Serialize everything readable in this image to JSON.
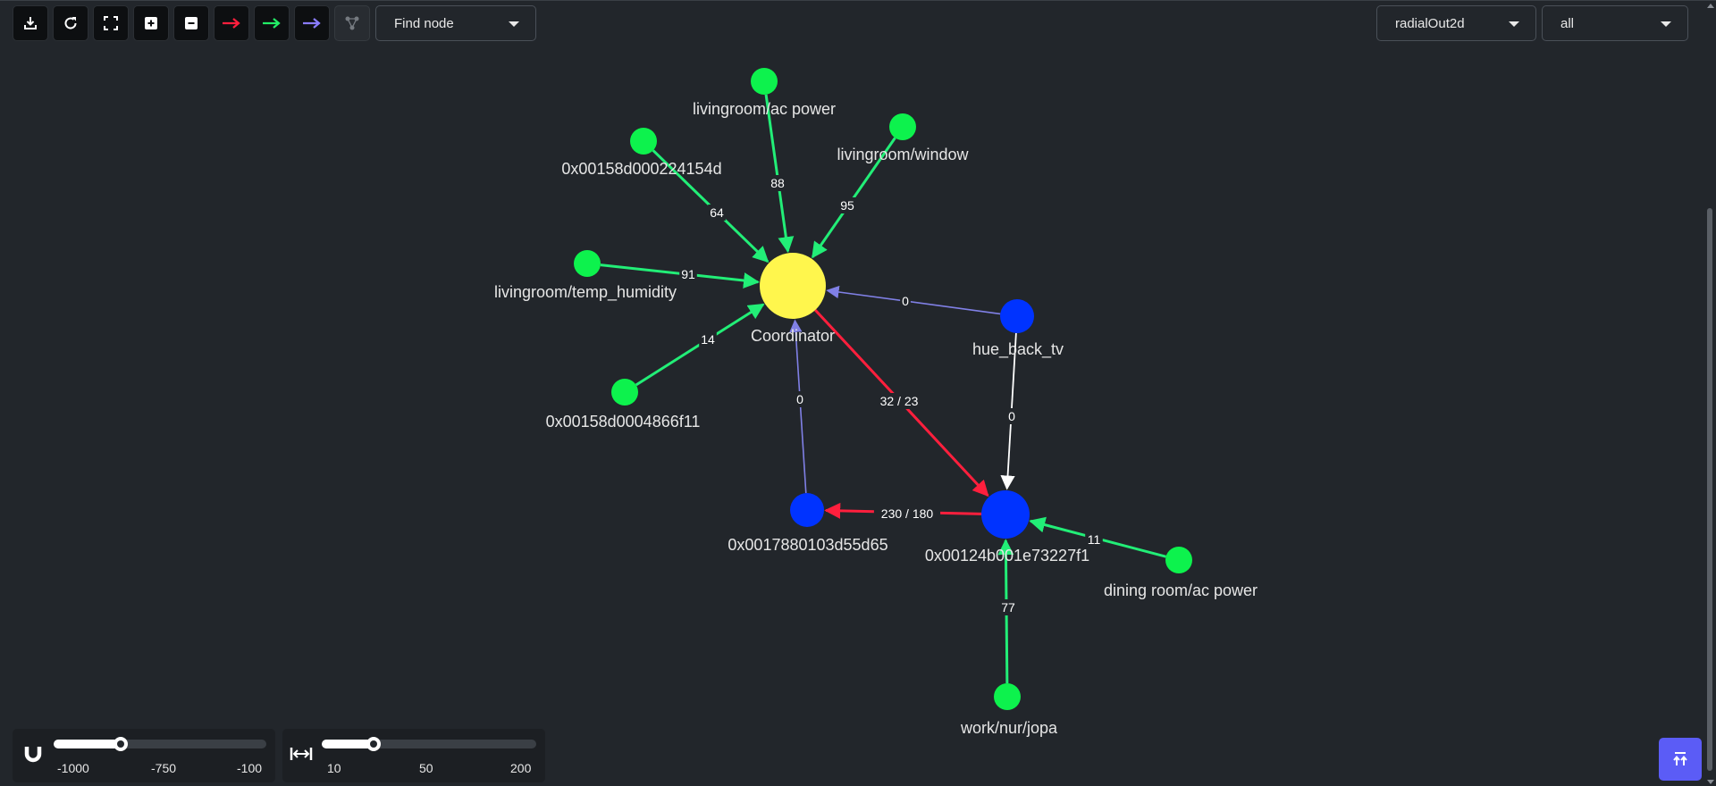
{
  "toolbar": {
    "buttons": [
      {
        "name": "download-icon"
      },
      {
        "name": "refresh-icon"
      },
      {
        "name": "fullscreen-icon"
      },
      {
        "name": "zoom-in-icon"
      },
      {
        "name": "zoom-out-icon"
      },
      {
        "name": "red-arrow-icon",
        "color": "#ff1f3d"
      },
      {
        "name": "green-arrow-icon",
        "color": "#22ee66"
      },
      {
        "name": "blue-arrow-icon",
        "color": "#8a7cff"
      },
      {
        "name": "network-icon",
        "disabled": true
      }
    ],
    "find_node": {
      "label": "Find node"
    }
  },
  "layout_select": {
    "value": "radialOut2d"
  },
  "filter_select": {
    "value": "all"
  },
  "colors": {
    "background": "#22262b",
    "coordinator": "#fff64d",
    "router": "#0033ff",
    "end_device": "#0df24d",
    "link_green": "#22ee77",
    "link_red": "#ff1f3d",
    "link_blue": "#8080e6",
    "link_white": "#ffffff"
  },
  "graph": {
    "nodes": [
      {
        "id": "coordinator",
        "label": "Coordinator",
        "type": "coordinator"
      },
      {
        "id": "acpower",
        "label": "livingroom/ac power",
        "type": "end"
      },
      {
        "id": "window",
        "label": "livingroom/window",
        "type": "end"
      },
      {
        "id": "n224154d",
        "label": "0x00158d000224154d",
        "type": "end"
      },
      {
        "id": "temphum",
        "label": "livingroom/temp_humidity",
        "type": "end"
      },
      {
        "id": "n4866f11",
        "label": "0x00158d0004866f11",
        "type": "end"
      },
      {
        "id": "hue",
        "label": "hue_back_tv",
        "type": "router"
      },
      {
        "id": "n3d55d65",
        "label": "0x0017880103d55d65",
        "type": "router"
      },
      {
        "id": "n73227f1",
        "label": "0x00124b001e73227f1",
        "type": "router"
      },
      {
        "id": "dining",
        "label": "dining room/ac power",
        "type": "end"
      },
      {
        "id": "jopa",
        "label": "work/nur/jopa",
        "type": "end"
      }
    ],
    "links": [
      {
        "from": "acpower",
        "to": "coordinator",
        "label": "88",
        "color": "green"
      },
      {
        "from": "window",
        "to": "coordinator",
        "label": "95",
        "color": "green"
      },
      {
        "from": "n224154d",
        "to": "coordinator",
        "label": "64",
        "color": "green"
      },
      {
        "from": "temphum",
        "to": "coordinator",
        "label": "91",
        "color": "green"
      },
      {
        "from": "n4866f11",
        "to": "coordinator",
        "label": "14",
        "color": "green"
      },
      {
        "from": "hue",
        "to": "coordinator",
        "label": "0",
        "color": "blue"
      },
      {
        "from": "n3d55d65",
        "to": "coordinator",
        "label": "0",
        "color": "blue"
      },
      {
        "from": "coordinator",
        "to": "n73227f1",
        "label": "32 / 23",
        "color": "red"
      },
      {
        "from": "hue",
        "to": "n73227f1",
        "label": "0",
        "color": "white"
      },
      {
        "from": "n73227f1",
        "to": "n3d55d65",
        "label": "230 / 180",
        "color": "red"
      },
      {
        "from": "dining",
        "to": "n73227f1",
        "label": "11",
        "color": "green"
      },
      {
        "from": "jopa",
        "to": "n73227f1",
        "label": "77",
        "color": "green"
      }
    ]
  },
  "charge_slider": {
    "icon": "magnet-icon",
    "min_label": "-1000",
    "mid_label": "-750",
    "max_label": "-100",
    "value": -750
  },
  "distance_slider": {
    "icon": "distance-icon",
    "min_label": "10",
    "mid_label": "50",
    "max_label": "200",
    "value": 50
  },
  "scroll_top": {
    "icon": "scroll-to-top-icon"
  }
}
